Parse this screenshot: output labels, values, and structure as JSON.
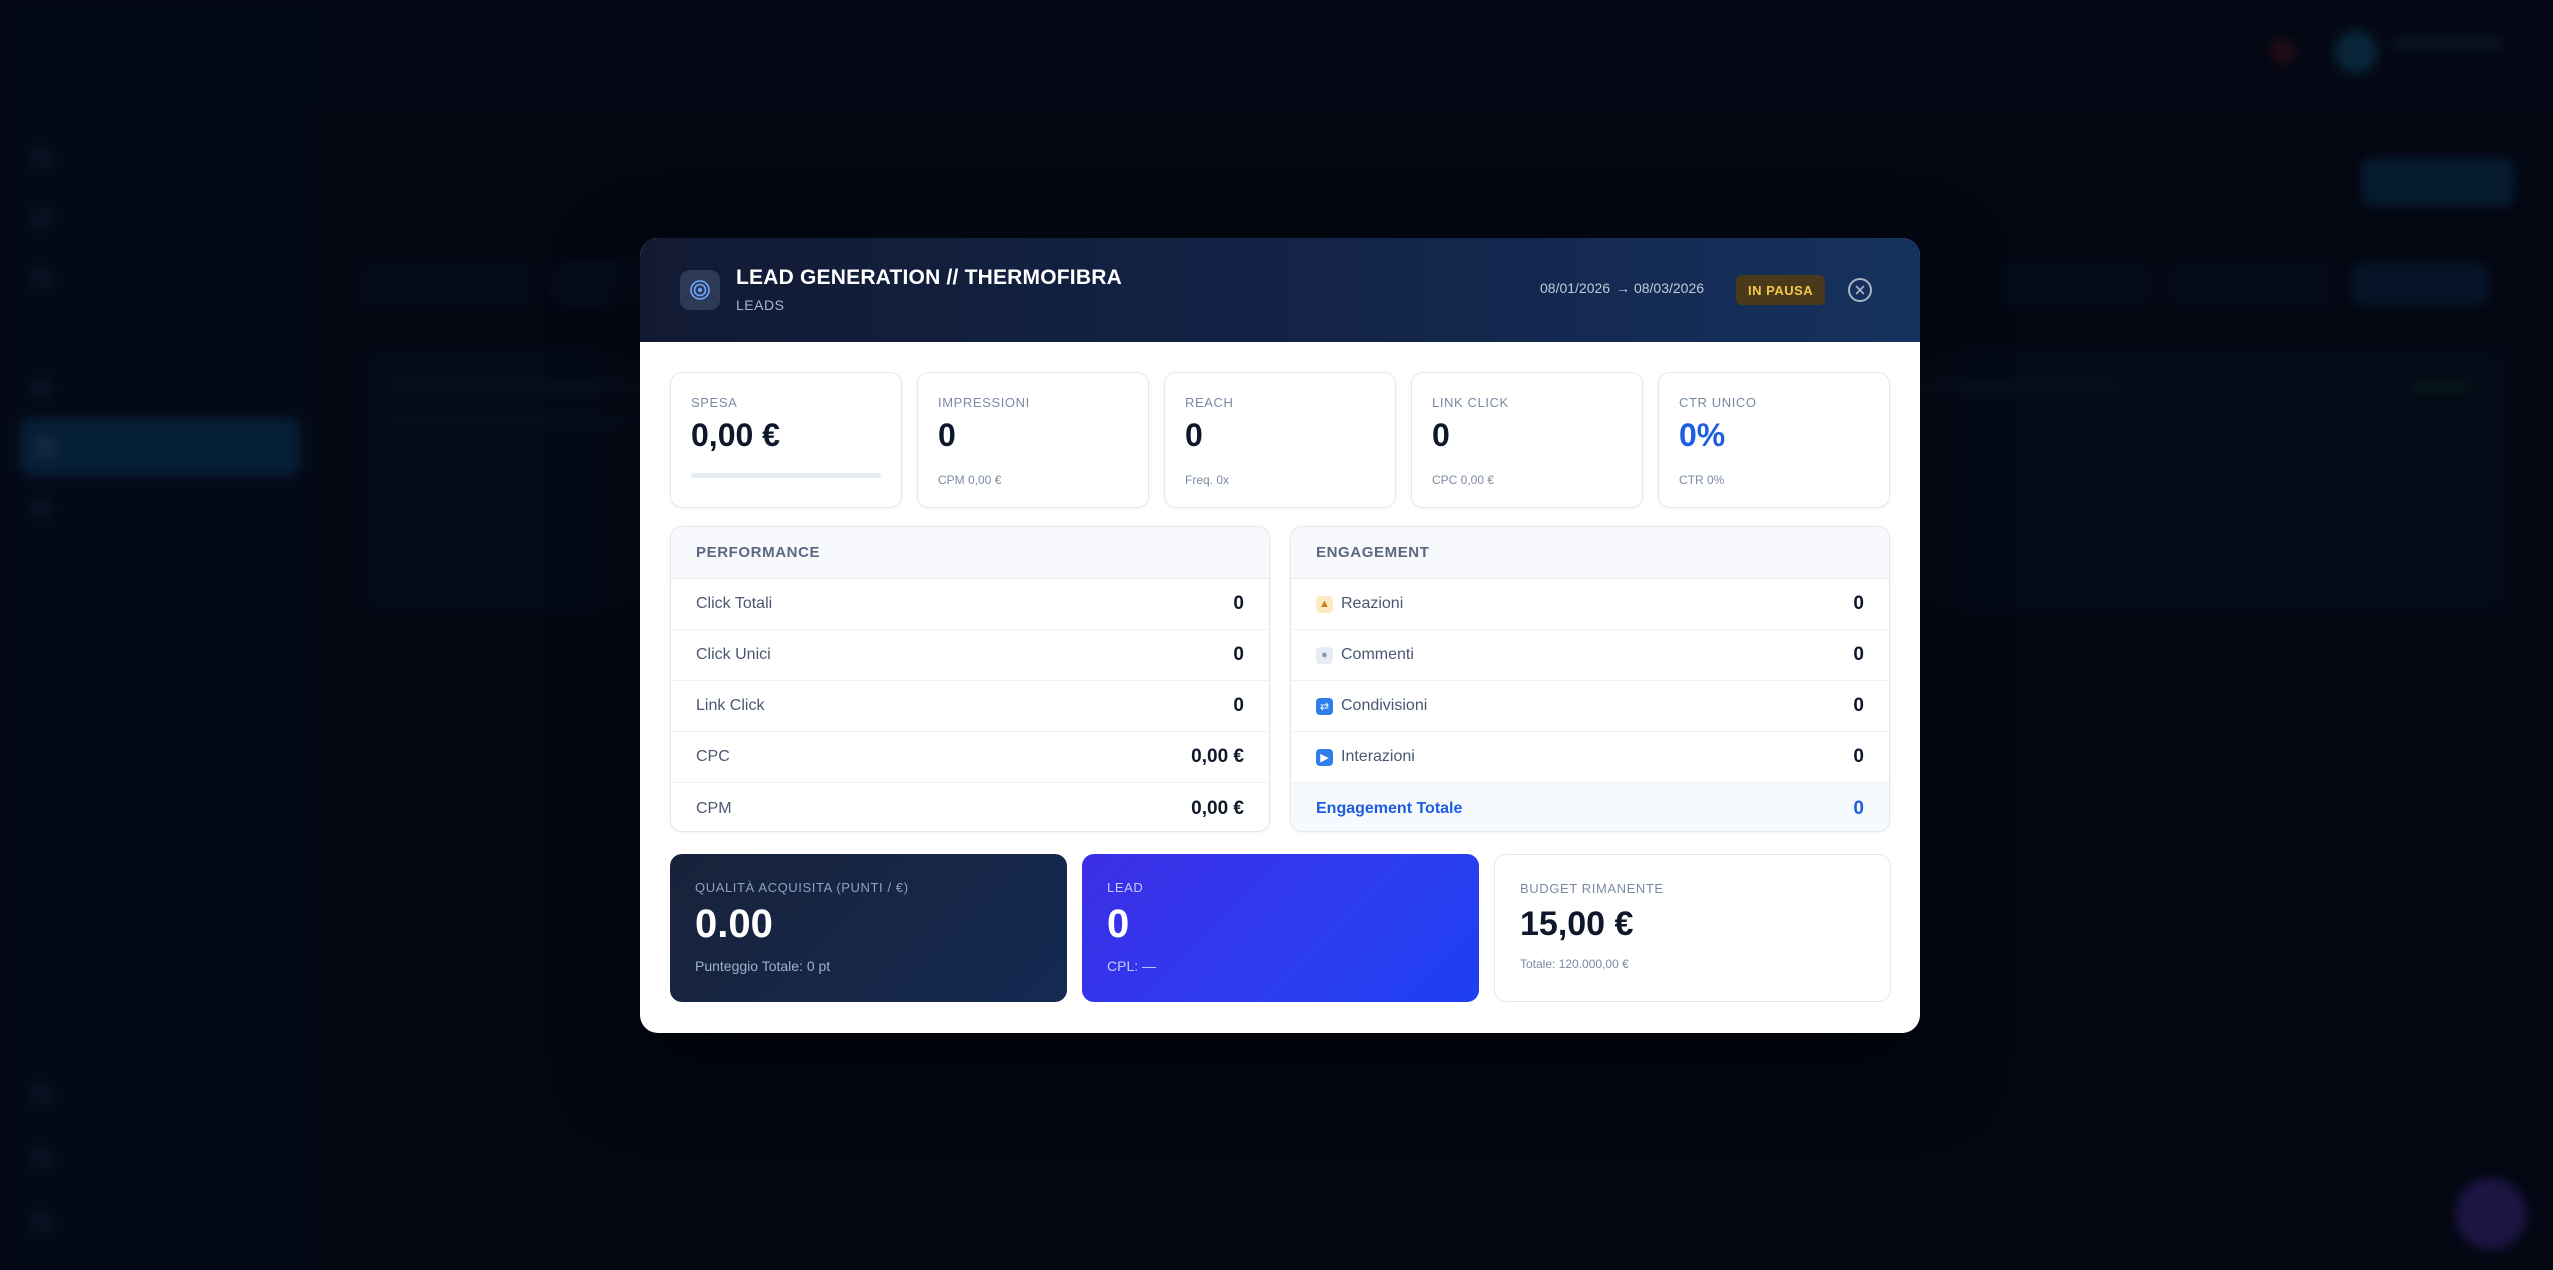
{
  "modal": {
    "title": "LEAD GENERATION // THERMOFIBRA",
    "subtitle": "LEADS",
    "date_start": "08/01/2026",
    "date_end": "→ 08/03/2026",
    "status": "IN PAUSA",
    "colors": {
      "accent": "#1d5de0",
      "status_bg": "#4a3a1c",
      "status_text": "#f4c64a",
      "header_bg": "#121a33"
    }
  },
  "metrics": [
    {
      "label": "SPESA",
      "value": "0,00 €",
      "sub": "",
      "progress": 0
    },
    {
      "label": "IMPRESSIONI",
      "value": "0",
      "sub": "CPM 0,00 €"
    },
    {
      "label": "REACH",
      "value": "0",
      "sub": "Freq. 0x"
    },
    {
      "label": "LINK CLICK",
      "value": "0",
      "sub": "CPC 0,00 €"
    },
    {
      "label": "CTR UNICO",
      "value": "0%",
      "sub": "CTR 0%"
    }
  ],
  "performance": {
    "title": "PERFORMANCE",
    "rows": [
      {
        "label": "Click Totali",
        "value": "0"
      },
      {
        "label": "Click Unici",
        "value": "0"
      },
      {
        "label": "Link Click",
        "value": "0"
      },
      {
        "label": "CPC",
        "value": "0,00 €"
      },
      {
        "label": "CPM",
        "value": "0,00 €"
      }
    ]
  },
  "engagement": {
    "title": "ENGAGEMENT",
    "rows": [
      {
        "label": "Reazioni",
        "value": "0",
        "icon": "thumbs-up-icon"
      },
      {
        "label": "Commenti",
        "value": "0",
        "icon": "speech-bubble-icon"
      },
      {
        "label": "Condivisioni",
        "value": "0",
        "icon": "share-icon"
      },
      {
        "label": "Interazioni",
        "value": "0",
        "icon": "play-icon"
      }
    ],
    "total_label": "Engagement Totale",
    "total_value": "0"
  },
  "bottom": {
    "quality": {
      "label": "QUALITÀ ACQUISITA (PUNTI / €)",
      "value": "0.00",
      "sub": "Punteggio Totale: 0 pt"
    },
    "lead": {
      "label": "LEAD",
      "value": "0",
      "sub": "CPL: —"
    },
    "budget": {
      "label": "BUDGET RIMANENTE",
      "value": "15,00 €",
      "sub": "Totale: 120.000,00 €"
    }
  }
}
